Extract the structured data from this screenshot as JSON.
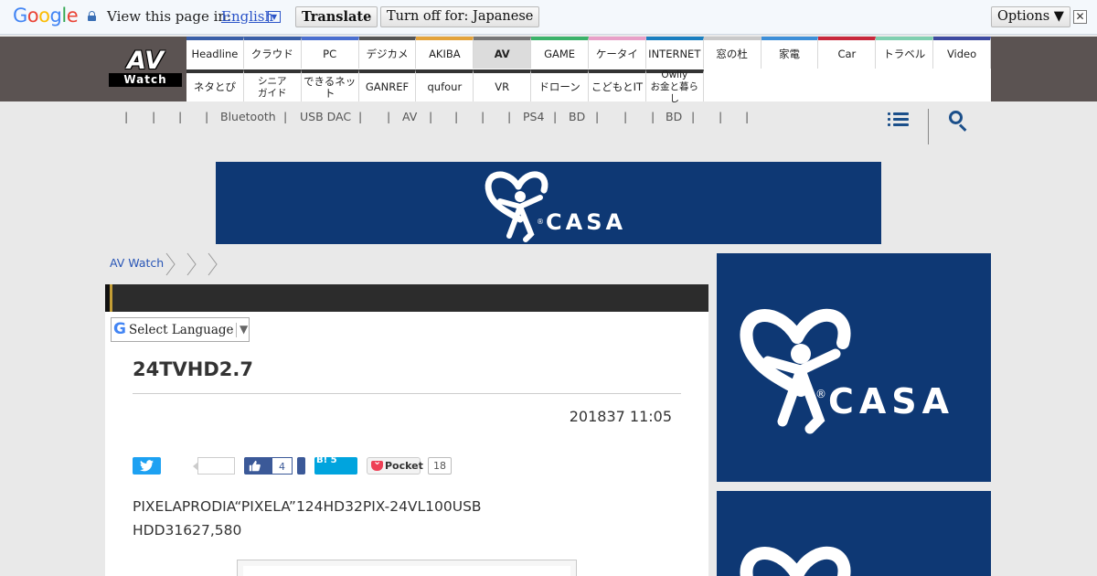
{
  "translate_bar": {
    "logo": "Google",
    "prompt": "View this page in:",
    "language": "English",
    "language_dropdown": "▼",
    "translate_label": "Translate",
    "turn_off_label": "Turn off for: Japanese",
    "options_label": "Options ▼",
    "close_label": "✕"
  },
  "site": {
    "logo_top": "AV",
    "logo_bottom": "Watch",
    "nav_row1": [
      "Headline",
      "クラウド",
      "PC",
      "デジカメ",
      "AKIBA",
      "AV",
      "GAME",
      "ケータイ",
      "INTERNET",
      "窓の杜",
      "家電",
      "Car",
      "トラベル",
      "Video"
    ],
    "nav_row2": [
      "ネタとぴ",
      "シニア\nガイド",
      "できるネット",
      "GANREF",
      "qufour",
      "VR",
      "ドローン",
      "こどもとIT",
      "Owlly\nお金と暮らし"
    ],
    "nav_active": "AV",
    "nav_colors": [
      "#3a5fa8",
      "#3a5fa8",
      "#4a6fd0",
      "#555555",
      "#e3a33c",
      "#777777",
      "#3bb26a",
      "#e8a0c8",
      "#1a7fc0",
      "#c9c9c9",
      "#3d8fd8",
      "#c8283c",
      "#7fcfb0",
      "#3d4aa0"
    ]
  },
  "keywords": {
    "items": [
      "Bluetooth",
      "USB DAC",
      "AV",
      "PS4",
      "BD",
      "BD"
    ]
  },
  "banner": {
    "brand": "CASA",
    "reg": "®"
  },
  "breadcrumb": {
    "home": "AV Watch"
  },
  "language_selector": {
    "g_letter": "G",
    "label": "Select Language",
    "arrow": "▼"
  },
  "article": {
    "title": "24TVHD2.7",
    "date": "201837 11:05",
    "lead_line1": "PIXELAPRODIA“PIXELA”124HD32PIX-24VL100USB",
    "lead_line2": "HDD31627,580"
  },
  "social": {
    "facebook_count": "4",
    "hatena_label": "B!",
    "hatena_count": "5",
    "pocket_label": "Pocket",
    "pocket_count": "18"
  },
  "sidebar": {
    "ad_brand": "CASA",
    "ad_reg": "®"
  },
  "colors": {
    "casa_blue": "#0e3874",
    "header_bg": "#5b5352",
    "link_blue": "#2855b6"
  }
}
